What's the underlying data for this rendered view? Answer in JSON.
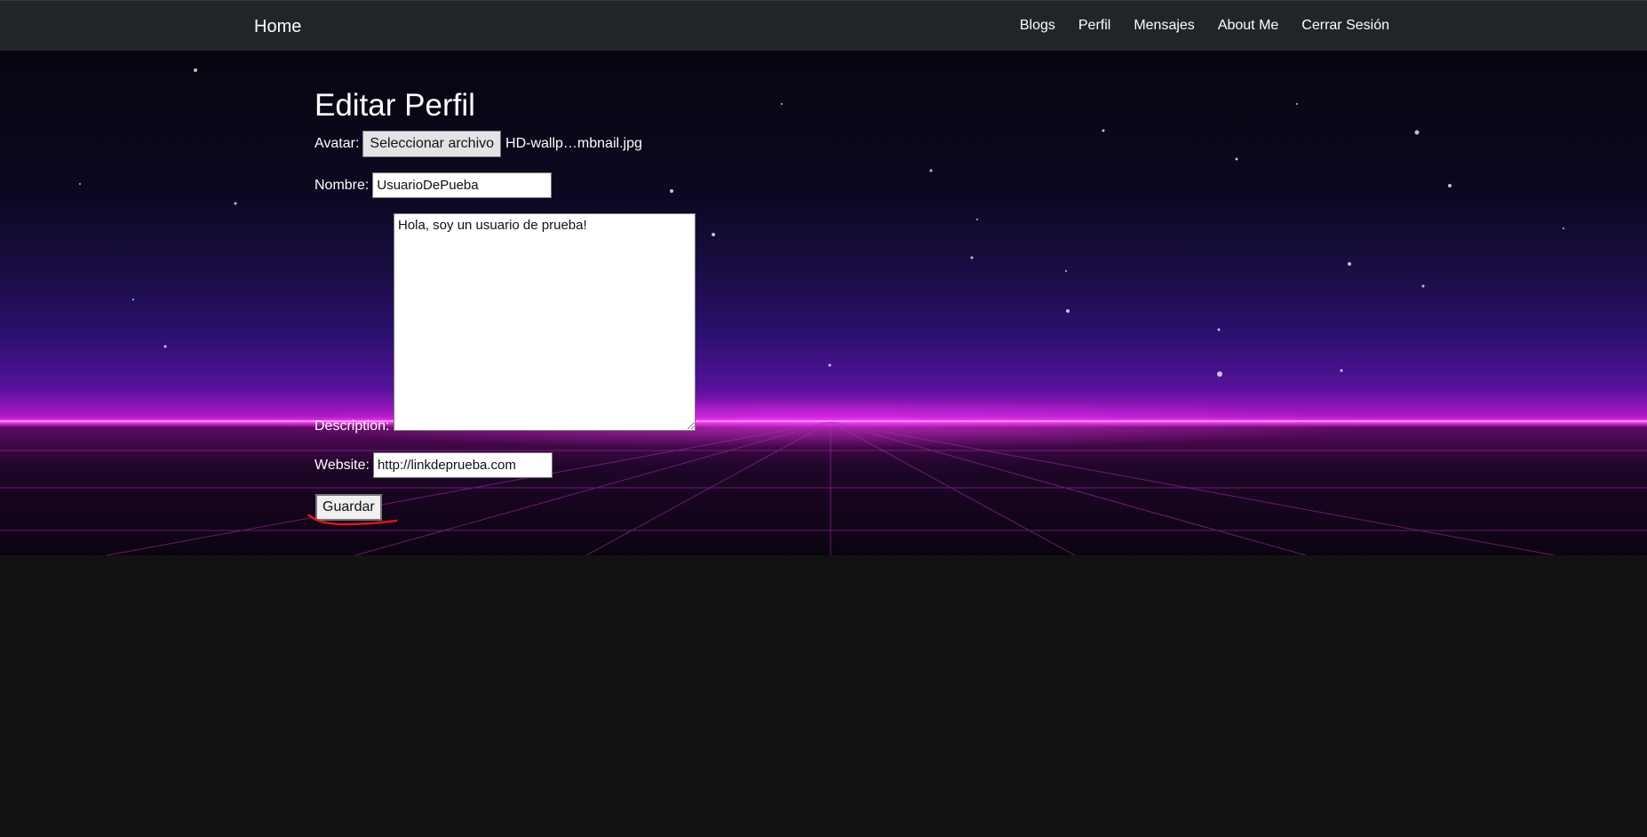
{
  "navbar": {
    "brand": "Home",
    "links": [
      "Blogs",
      "Perfil",
      "Mensajes",
      "About Me",
      "Cerrar Sesión"
    ]
  },
  "form": {
    "title": "Editar Perfil",
    "avatar_label": "Avatar:",
    "file_button_label": "Seleccionar archivo",
    "file_name": "HD-wallp…mbnail.jpg",
    "name_label": "Nombre:",
    "name_value": "UsuarioDePueba",
    "description_label": "Description:",
    "description_value": "Hola, soy un usuario de prueba!",
    "website_label": "Website:",
    "website_value": "http://linkdeprueba.com",
    "save_label": "Guardar"
  },
  "colors": {
    "navbar_bg": "#212529",
    "page_bg": "#121212",
    "horizon_glow": "#ff3cff",
    "annotation_underline": "#e0161e"
  }
}
